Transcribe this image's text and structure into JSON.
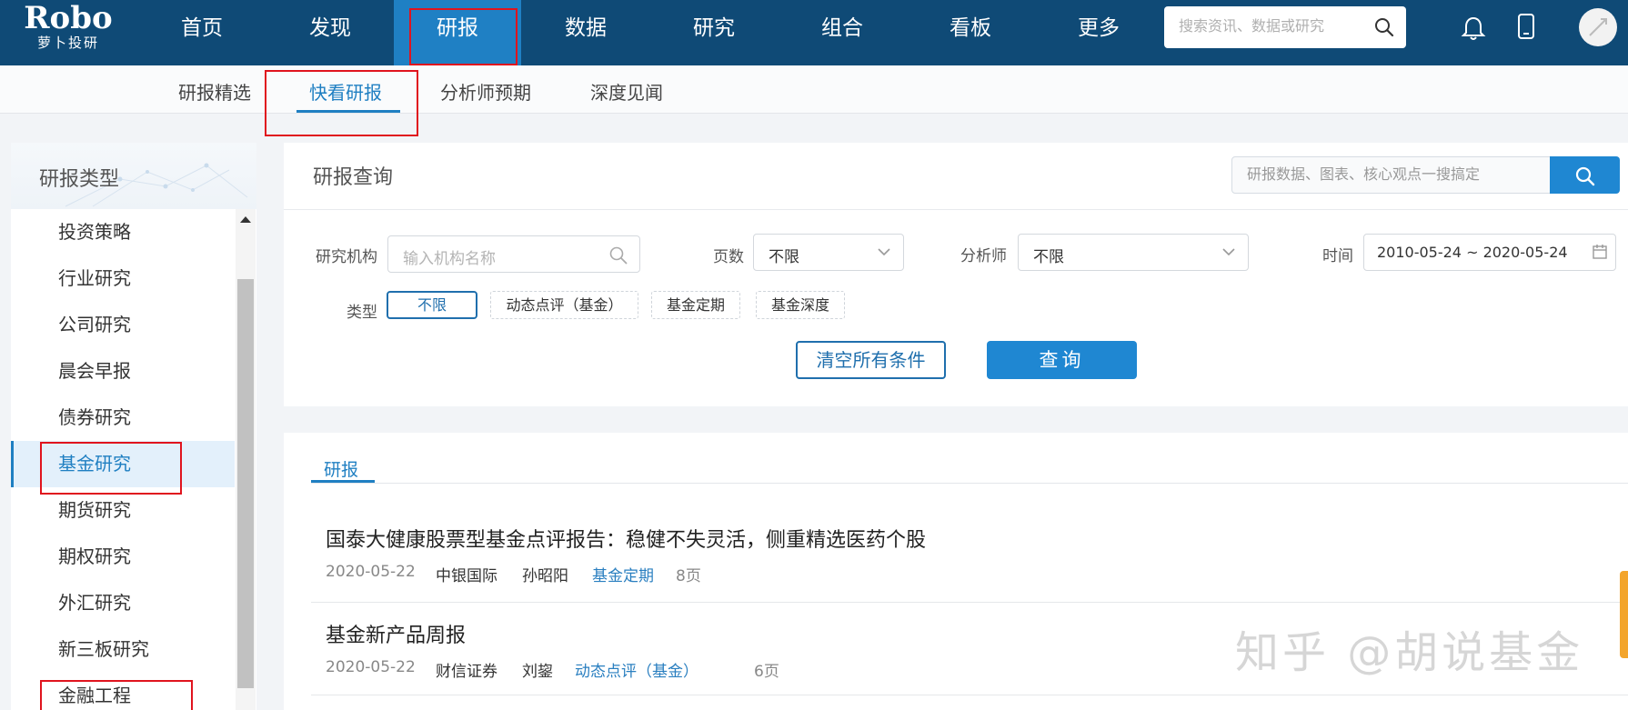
{
  "brand": {
    "name": "Robo",
    "subname": "萝卜投研"
  },
  "topnav": {
    "items": [
      {
        "label": "首页"
      },
      {
        "label": "发现"
      },
      {
        "label": "研报"
      },
      {
        "label": "数据"
      },
      {
        "label": "研究"
      },
      {
        "label": "组合"
      },
      {
        "label": "看板"
      },
      {
        "label": "更多"
      }
    ],
    "active_index": 2,
    "search_placeholder": "搜索资讯、数据或研究",
    "icons": [
      "search-icon",
      "bell-icon",
      "phone-icon",
      "avatar"
    ]
  },
  "subnav": {
    "items": [
      {
        "label": "研报精选"
      },
      {
        "label": "快看研报"
      },
      {
        "label": "分析师预期"
      },
      {
        "label": "深度见闻"
      }
    ],
    "active_index": 1
  },
  "sidebar": {
    "title": "研报类型",
    "items": [
      {
        "label": "投资策略"
      },
      {
        "label": "行业研究"
      },
      {
        "label": "公司研究"
      },
      {
        "label": "晨会早报"
      },
      {
        "label": "债券研究"
      },
      {
        "label": "基金研究"
      },
      {
        "label": "期货研究"
      },
      {
        "label": "期权研究"
      },
      {
        "label": "外汇研究"
      },
      {
        "label": "新三板研究"
      },
      {
        "label": "金融工程"
      }
    ],
    "active_index": 5
  },
  "query": {
    "title": "研报查询",
    "search_placeholder": "研报数据、图表、核心观点一搜搞定",
    "institution_label": "研究机构",
    "institution_placeholder": "输入机构名称",
    "pages_label": "页数",
    "pages_value": "不限",
    "analyst_label": "分析师",
    "analyst_value": "不限",
    "time_label": "时间",
    "time_value": "2010-05-24 ~ 2020-05-24",
    "type_label": "类型",
    "types": [
      {
        "label": "不限"
      },
      {
        "label": "动态点评（基金）"
      },
      {
        "label": "基金定期"
      },
      {
        "label": "基金深度"
      }
    ],
    "active_type_index": 0,
    "clear_label": "清空所有条件",
    "query_label": "查询"
  },
  "results": {
    "tab_label": "研报",
    "reports": [
      {
        "title": "国泰大健康股票型基金点评报告：稳健不失灵活，侧重精选医药个股",
        "date": "2020-05-22",
        "institution": "中银国际",
        "analyst": "孙昭阳",
        "type": "基金定期",
        "pages": "8页"
      },
      {
        "title": "基金新产品周报",
        "date": "2020-05-22",
        "institution": "财信证券",
        "analyst": "刘鋆",
        "type": "动态点评（基金）",
        "pages": "6页"
      }
    ]
  },
  "watermark": "知乎 @胡说基金",
  "colors": {
    "topnav_bg": "#0f4a76",
    "active_blue": "#1f80c4",
    "link_blue": "#1f7fc2",
    "highlight_red": "#e0141e",
    "accent_orange": "#f3a52c"
  }
}
